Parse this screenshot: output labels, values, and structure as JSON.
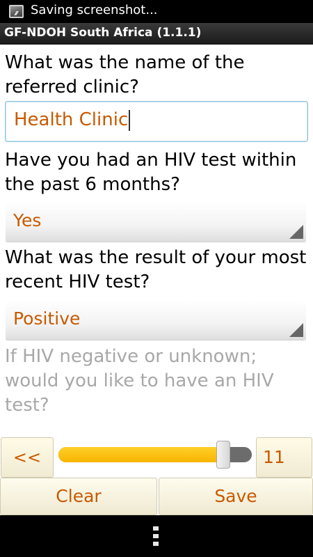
{
  "status_bar": {
    "text": "Saving screenshot...",
    "icon": "screenshot-icon"
  },
  "app": {
    "title": "GF-NDOH South Africa (1.1.1)"
  },
  "form": {
    "q1": {
      "label": "What was the name of the referred clinic?",
      "value": "Health Clinic"
    },
    "q2": {
      "label": "Have you had an HIV test within the past 6 months?",
      "value": "Yes"
    },
    "q3": {
      "label": "What was the result of your most recent HIV test?",
      "value": "Positive"
    },
    "q4": {
      "label": "If HIV negative or unknown; would you like to have an HIV test?"
    }
  },
  "navigation": {
    "prev_label": "<<",
    "page_number": "11",
    "progress_fraction": 0.88
  },
  "actions": {
    "clear_label": "Clear",
    "save_label": "Save"
  },
  "system_nav": {
    "icon": "menu-icon"
  },
  "colors": {
    "accent": "#c75a00",
    "slider_fill": "#f7b400",
    "disabled_text": "#a8a8a8"
  }
}
